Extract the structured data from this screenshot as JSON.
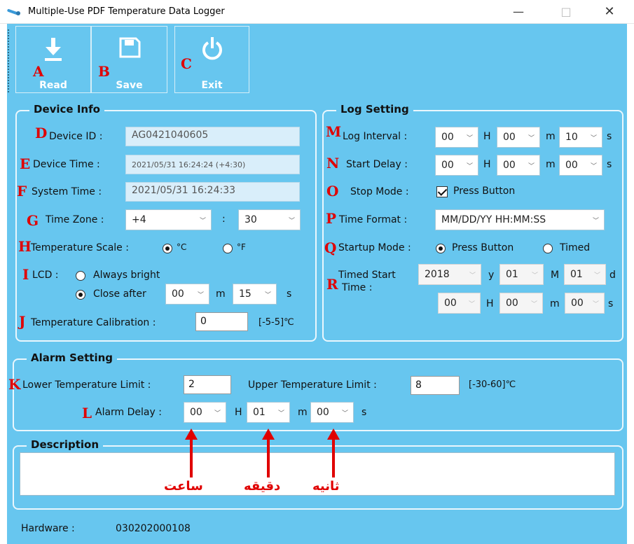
{
  "window": {
    "title": "Multiple-Use PDF Temperature Data Logger",
    "minimize": "—",
    "maximize": "□",
    "close": "✕"
  },
  "toolbar": {
    "read": "Read",
    "save": "Save",
    "exit": "Exit"
  },
  "device_info": {
    "title": "Device Info",
    "device_id_label": "Device ID :",
    "device_id": "AG0421040605",
    "device_time_label": "Device Time :",
    "device_time": "2021/05/31 16:24:24 (+4:30)",
    "system_time_label": "System Time :",
    "system_time": "2021/05/31 16:24:33",
    "time_zone_label": "Time Zone :",
    "tz_hours": "+4",
    "tz_sep": ":",
    "tz_minutes": "30",
    "temp_scale_label": "Temperature Scale :",
    "celsius": "°C",
    "fahrenheit": "°F",
    "lcd_label": "LCD :",
    "always_bright": "Always bright",
    "close_after": "Close after",
    "lcd_minutes": "00",
    "lcd_m": "m",
    "lcd_seconds": "15",
    "lcd_s": "s",
    "calibration_label": "Temperature Calibration :",
    "calibration": "0",
    "calibration_range": "[-5-5]℃"
  },
  "log_setting": {
    "title": "Log Setting",
    "interval_label": "Log Interval :",
    "interval": [
      "00",
      "00",
      "10"
    ],
    "delay_label": "Start Delay :",
    "delay": [
      "00",
      "00",
      "00"
    ],
    "h": "H",
    "m": "m",
    "s": "s",
    "stop_mode_label": "Stop Mode :",
    "stop_mode": "Press Button",
    "time_format_label": "Time Format :",
    "time_format": "MM/DD/YY HH:MM:SS",
    "startup_label": "Startup Mode :",
    "startup_press": "Press Button",
    "startup_timed": "Timed",
    "timed_start_label": "Timed Start\nTime :",
    "timed_start_label_1": "Timed Start",
    "timed_start_label_2": "Time :",
    "ts_year": "2018",
    "y": "y",
    "ts_month": "01",
    "M": "M",
    "ts_day": "01",
    "d": "d",
    "ts_hour": "00",
    "ts_minute": "00",
    "ts_second": "00"
  },
  "alarm": {
    "title": "Alarm Setting",
    "lower_label": "Lower Temperature Limit :",
    "lower": "2",
    "upper_label": "Upper Temperature Limit :",
    "upper": "8",
    "range": "[-30-60]℃",
    "delay_label": "Alarm Delay :",
    "delay_h": "00",
    "delay_m": "01",
    "delay_s": "00",
    "h": "H",
    "m": "m",
    "s": "s"
  },
  "description": {
    "title": "Description"
  },
  "hardware": {
    "label": "Hardware :",
    "value": "030202000108"
  },
  "annotations": {
    "letters": [
      "A",
      "B",
      "C",
      "D",
      "E",
      "F",
      "G",
      "H",
      "I",
      "J",
      "K",
      "L",
      "M",
      "N",
      "O",
      "P",
      "Q",
      "R"
    ],
    "hour": "ساعت",
    "minute": "دقیقه",
    "second": "ثانیه",
    "color": "#e00000"
  },
  "colors": {
    "panel": "#67c6ef",
    "accent": "#e00000"
  }
}
